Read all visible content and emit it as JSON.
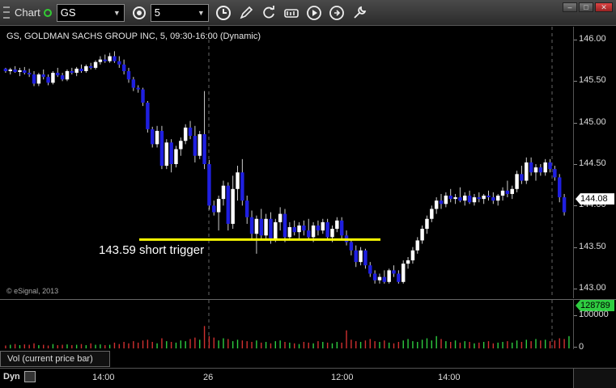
{
  "toolbar": {
    "title": "Chart",
    "symbol": "GS",
    "interval": "5"
  },
  "chart": {
    "title": "GS, GOLDMAN SACHS GROUP INC, 5, 09:30-16:00 (Dynamic)",
    "copyright": "© eSignal, 2013",
    "annotation": "143.59 short trigger",
    "last_price": "144.08",
    "price_ticks": [
      "146.00",
      "145.50",
      "145.00",
      "144.50",
      "144.00",
      "143.50",
      "143.00"
    ],
    "volume_last": "128789",
    "volume_ticks": [
      "100000",
      "0"
    ],
    "volume_label": "Vol (current price bar)",
    "time_ticks": [
      "14:00",
      "26",
      "12:00",
      "14:00"
    ],
    "dyn_label": "Dyn",
    "colors": {
      "up": "#ffffff",
      "down": "#1f1fe0",
      "trigger": "#ffff00",
      "vol_up": "#2ecc40",
      "vol_down": "#d03030"
    }
  },
  "chart_data": {
    "type": "candlestick",
    "title": "GS, GOLDMAN SACHS GROUP INC, 5, 09:30-16:00 (Dynamic)",
    "ylim": [
      143.0,
      146.1
    ],
    "trigger_level": 143.59,
    "ohlc": [
      [
        145.65,
        145.66,
        145.6,
        145.62
      ],
      [
        145.62,
        145.66,
        145.58,
        145.64
      ],
      [
        145.64,
        145.68,
        145.6,
        145.61
      ],
      [
        145.61,
        145.66,
        145.56,
        145.63
      ],
      [
        145.63,
        145.67,
        145.58,
        145.6
      ],
      [
        145.6,
        145.65,
        145.55,
        145.58
      ],
      [
        145.58,
        145.62,
        145.44,
        145.47
      ],
      [
        145.47,
        145.6,
        145.44,
        145.58
      ],
      [
        145.58,
        145.64,
        145.52,
        145.55
      ],
      [
        145.55,
        145.58,
        145.45,
        145.48
      ],
      [
        145.48,
        145.62,
        145.46,
        145.6
      ],
      [
        145.6,
        145.66,
        145.55,
        145.57
      ],
      [
        145.57,
        145.6,
        145.5,
        145.52
      ],
      [
        145.52,
        145.64,
        145.5,
        145.62
      ],
      [
        145.62,
        145.66,
        145.58,
        145.6
      ],
      [
        145.6,
        145.67,
        145.56,
        145.65
      ],
      [
        145.65,
        145.7,
        145.6,
        145.62
      ],
      [
        145.62,
        145.7,
        145.6,
        145.68
      ],
      [
        145.68,
        145.72,
        145.64,
        145.66
      ],
      [
        145.66,
        145.75,
        145.64,
        145.73
      ],
      [
        145.73,
        145.8,
        145.7,
        145.76
      ],
      [
        145.76,
        145.82,
        145.72,
        145.74
      ],
      [
        145.74,
        145.84,
        145.72,
        145.8
      ],
      [
        145.8,
        145.86,
        145.72,
        145.74
      ],
      [
        145.74,
        145.8,
        145.66,
        145.7
      ],
      [
        145.7,
        145.76,
        145.58,
        145.62
      ],
      [
        145.62,
        145.66,
        145.48,
        145.52
      ],
      [
        145.52,
        145.55,
        145.38,
        145.42
      ],
      [
        145.42,
        145.45,
        145.36,
        145.4
      ],
      [
        145.4,
        145.42,
        145.2,
        145.24
      ],
      [
        145.24,
        145.26,
        144.88,
        144.92
      ],
      [
        144.92,
        144.95,
        144.7,
        144.74
      ],
      [
        144.74,
        144.96,
        144.7,
        144.9
      ],
      [
        144.9,
        144.96,
        144.44,
        144.48
      ],
      [
        144.48,
        144.8,
        144.44,
        144.76
      ],
      [
        144.76,
        144.8,
        144.4,
        144.5
      ],
      [
        144.5,
        144.72,
        144.46,
        144.68
      ],
      [
        144.68,
        144.82,
        144.6,
        144.78
      ],
      [
        144.78,
        144.98,
        144.74,
        144.94
      ],
      [
        144.94,
        145.02,
        144.8,
        144.84
      ],
      [
        144.84,
        144.96,
        144.52,
        144.6
      ],
      [
        144.6,
        144.9,
        144.56,
        144.86
      ],
      [
        144.86,
        145.38,
        144.44,
        144.5
      ],
      [
        144.5,
        144.55,
        143.95,
        144.0
      ],
      [
        144.0,
        144.06,
        143.88,
        143.92
      ],
      [
        143.92,
        144.12,
        143.7,
        144.08
      ],
      [
        144.08,
        144.3,
        144.0,
        144.24
      ],
      [
        144.24,
        144.28,
        143.7,
        143.78
      ],
      [
        143.78,
        144.36,
        143.72,
        144.2
      ],
      [
        144.2,
        144.48,
        144.06,
        144.4
      ],
      [
        144.4,
        144.56,
        144.0,
        144.06
      ],
      [
        144.06,
        144.12,
        143.78,
        143.86
      ],
      [
        143.86,
        143.94,
        143.6,
        143.66
      ],
      [
        143.66,
        143.88,
        143.42,
        143.84
      ],
      [
        143.84,
        143.96,
        143.6,
        143.64
      ],
      [
        143.64,
        143.9,
        143.58,
        143.84
      ],
      [
        143.84,
        143.92,
        143.54,
        143.58
      ],
      [
        143.58,
        143.84,
        143.56,
        143.8
      ],
      [
        143.8,
        143.98,
        143.7,
        143.9
      ],
      [
        143.9,
        143.96,
        143.56,
        143.62
      ],
      [
        143.62,
        143.8,
        143.58,
        143.74
      ],
      [
        143.74,
        143.82,
        143.64,
        143.68
      ],
      [
        143.68,
        143.8,
        143.6,
        143.76
      ],
      [
        143.76,
        143.82,
        143.64,
        143.7
      ],
      [
        143.7,
        143.84,
        143.58,
        143.62
      ],
      [
        143.62,
        143.8,
        143.56,
        143.76
      ],
      [
        143.76,
        143.82,
        143.64,
        143.7
      ],
      [
        143.7,
        143.84,
        143.66,
        143.8
      ],
      [
        143.8,
        143.84,
        143.58,
        143.62
      ],
      [
        143.62,
        143.76,
        143.56,
        143.72
      ],
      [
        143.72,
        143.86,
        143.68,
        143.82
      ],
      [
        143.82,
        143.86,
        143.6,
        143.64
      ],
      [
        143.64,
        143.7,
        143.52,
        143.56
      ],
      [
        143.56,
        143.6,
        143.4,
        143.46
      ],
      [
        143.46,
        143.52,
        143.26,
        143.32
      ],
      [
        143.32,
        143.5,
        143.28,
        143.46
      ],
      [
        143.46,
        143.48,
        143.24,
        143.28
      ],
      [
        143.28,
        143.32,
        143.14,
        143.18
      ],
      [
        143.18,
        143.22,
        143.06,
        143.1
      ],
      [
        143.1,
        143.18,
        143.06,
        143.14
      ],
      [
        143.14,
        143.22,
        143.06,
        143.08
      ],
      [
        143.08,
        143.24,
        143.06,
        143.22
      ],
      [
        143.22,
        143.28,
        143.14,
        143.18
      ],
      [
        143.18,
        143.22,
        143.06,
        143.08
      ],
      [
        143.08,
        143.34,
        143.06,
        143.3
      ],
      [
        143.3,
        143.38,
        143.24,
        143.34
      ],
      [
        143.34,
        143.5,
        143.3,
        143.46
      ],
      [
        143.46,
        143.62,
        143.42,
        143.58
      ],
      [
        143.58,
        143.76,
        143.54,
        143.72
      ],
      [
        143.72,
        143.88,
        143.66,
        143.84
      ],
      [
        143.84,
        144.0,
        143.8,
        143.96
      ],
      [
        143.96,
        144.1,
        143.9,
        144.06
      ],
      [
        144.06,
        144.14,
        143.96,
        144.02
      ],
      [
        144.02,
        144.16,
        143.98,
        144.12
      ],
      [
        144.12,
        144.2,
        144.04,
        144.08
      ],
      [
        144.08,
        144.14,
        144.02,
        144.1
      ],
      [
        144.1,
        144.22,
        144.04,
        144.06
      ],
      [
        144.06,
        144.16,
        144.0,
        144.12
      ],
      [
        144.12,
        144.18,
        144.02,
        144.04
      ],
      [
        144.04,
        144.14,
        144.0,
        144.1
      ],
      [
        144.1,
        144.16,
        144.04,
        144.08
      ],
      [
        144.08,
        144.14,
        144.02,
        144.12
      ],
      [
        144.12,
        144.18,
        144.06,
        144.1
      ],
      [
        144.1,
        144.16,
        144.02,
        144.06
      ],
      [
        144.06,
        144.14,
        144.0,
        144.12
      ],
      [
        144.12,
        144.22,
        144.06,
        144.18
      ],
      [
        144.18,
        144.3,
        144.1,
        144.14
      ],
      [
        144.14,
        144.24,
        144.08,
        144.2
      ],
      [
        144.2,
        144.42,
        144.16,
        144.38
      ],
      [
        144.38,
        144.48,
        144.26,
        144.3
      ],
      [
        144.3,
        144.58,
        144.26,
        144.52
      ],
      [
        144.52,
        144.58,
        144.36,
        144.4
      ],
      [
        144.4,
        144.5,
        144.3,
        144.46
      ],
      [
        144.46,
        144.5,
        144.36,
        144.4
      ],
      [
        144.4,
        144.56,
        144.36,
        144.52
      ],
      [
        144.52,
        144.56,
        144.4,
        144.44
      ],
      [
        144.44,
        144.48,
        144.3,
        144.34
      ],
      [
        144.34,
        144.38,
        144.04,
        144.1
      ],
      [
        144.1,
        144.14,
        143.88,
        143.92
      ]
    ],
    "volume": [
      8,
      10,
      12,
      9,
      11,
      10,
      14,
      9,
      10,
      8,
      12,
      9,
      10,
      11,
      9,
      10,
      12,
      9,
      14,
      10,
      11,
      9,
      10,
      16,
      12,
      18,
      14,
      20,
      16,
      22,
      24,
      18,
      14,
      28,
      20,
      18,
      16,
      22,
      20,
      26,
      30,
      24,
      62,
      34,
      30,
      22,
      28,
      26,
      20,
      24,
      22,
      20,
      18,
      22,
      16,
      18,
      14,
      20,
      22,
      18,
      16,
      14,
      12,
      18,
      16,
      14,
      20,
      18,
      16,
      14,
      18,
      16,
      50,
      24,
      20,
      18,
      22,
      26,
      20,
      18,
      22,
      16,
      14,
      18,
      22,
      26,
      20,
      18,
      24,
      28,
      22,
      34,
      26,
      20,
      18,
      22,
      16,
      20,
      18,
      14,
      16,
      18,
      20,
      14,
      16,
      18,
      20,
      16,
      22,
      18,
      24,
      20,
      26,
      22,
      24,
      20,
      22,
      28,
      26,
      34,
      110
    ]
  }
}
